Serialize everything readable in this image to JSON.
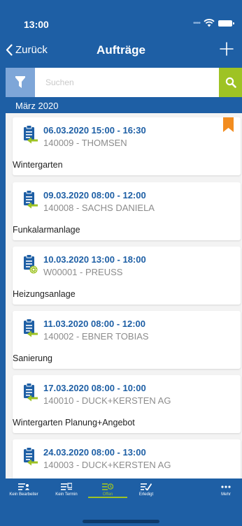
{
  "status_bar": {
    "time": "13:00"
  },
  "nav": {
    "back_label": "Zurück",
    "title": "Aufträge"
  },
  "search": {
    "placeholder": "Suchen"
  },
  "section": {
    "month": "März 2020"
  },
  "orders": [
    {
      "date": "06.03.2020 15:00 - 16:30",
      "customer": "140009 - THOMSEN",
      "title": "Wintergarten",
      "icon": "clipboard-arrow-icon",
      "flagged": true
    },
    {
      "date": "09.03.2020 08:00 - 12:00",
      "customer": "140008 - SACHS DANIELA",
      "title": "Funkalarmanlage",
      "icon": "clipboard-arrow-icon",
      "flagged": false
    },
    {
      "date": "10.03.2020 13:00 - 18:00",
      "customer": "W00001 - PREUSS",
      "title": "Heizungsanlage",
      "icon": "clipboard-gear-icon",
      "flagged": false
    },
    {
      "date": "11.03.2020 08:00 - 12:00",
      "customer": "140002 - EBNER TOBIAS",
      "title": "Sanierung",
      "icon": "clipboard-arrow-icon",
      "flagged": false
    },
    {
      "date": "17.03.2020 08:00 - 10:00",
      "customer": "140010 - DUCK+KERSTEN AG",
      "title": "Wintergarten Planung+Angebot",
      "icon": "clipboard-arrow-icon",
      "flagged": false
    },
    {
      "date": "24.03.2020 08:00 - 13:00",
      "customer": "140003 - DUCK+KERSTEN AG",
      "title": "",
      "icon": "clipboard-arrow-icon",
      "flagged": false
    }
  ],
  "tabs": [
    {
      "label": "Kein Bearbeiter",
      "icon": "list-person-icon",
      "active": false
    },
    {
      "label": "Kein Termin",
      "icon": "list-calendar-icon",
      "active": false
    },
    {
      "label": "Offen",
      "icon": "list-clock-icon",
      "active": true
    },
    {
      "label": "Erledigt",
      "icon": "list-check-icon",
      "active": false
    },
    {
      "label": "Mehr",
      "icon": "more-icon",
      "active": false
    }
  ],
  "colors": {
    "brand_blue": "#1e5fa5",
    "accent_green": "#9ec324",
    "flag_orange": "#f28c1f",
    "filter_blue": "#7ea6d8"
  }
}
